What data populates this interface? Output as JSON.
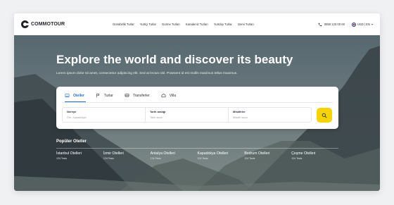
{
  "brand": {
    "name": "COMMOTOUR"
  },
  "nav": {
    "links": [
      "Günübirlik Turlar",
      "Yurtiçi Turlar",
      "Gurme Turları",
      "Karadeniz Turları",
      "Yurtdışı Turlar",
      "Gemi Turları"
    ],
    "phone": "0850 123 00 00",
    "lang": "USD | EN"
  },
  "hero": {
    "headline": "Explore the world and discover its beauty",
    "subline": "Lorem ipsum dolor sit amet, consectetur adipiscing elit. Sed at lectus nisl. Praesent id est mollis maximus tellus maximus."
  },
  "search": {
    "tabs": [
      {
        "label": "Oteller",
        "icon": "hotel-icon",
        "active": true
      },
      {
        "label": "Turlar",
        "icon": "flag-icon",
        "active": false
      },
      {
        "label": "Transferler",
        "icon": "bus-icon",
        "active": false
      },
      {
        "label": "Villa",
        "icon": "home-icon",
        "active": false
      }
    ],
    "fields": [
      {
        "label": "Nereye",
        "placeholder": "Örn. Kapadokya"
      },
      {
        "label": "Tarih aralığı",
        "placeholder": "Tarih seçin"
      },
      {
        "label": "Misafirler",
        "placeholder": "Misafir seçin"
      }
    ],
    "button_icon": "search-icon"
  },
  "popular": {
    "title": "Popüler Oteller",
    "items": [
      {
        "name": "İstanbul Otelleri",
        "count": "124 Tesis"
      },
      {
        "name": "İzmir Otelleri",
        "count": "124 Tesis"
      },
      {
        "name": "Antalya Otelleri",
        "count": "124 Tesis"
      },
      {
        "name": "Kapadokya Otelleri",
        "count": "124 Tesis"
      },
      {
        "name": "Bodrum Otelleri",
        "count": "124 Tesis"
      },
      {
        "name": "Çeşme Otelleri",
        "count": "124 Tesis"
      }
    ]
  },
  "colors": {
    "accent": "#1a6fd1",
    "search_button": "#f5d400",
    "text_dark": "#1f2328"
  }
}
